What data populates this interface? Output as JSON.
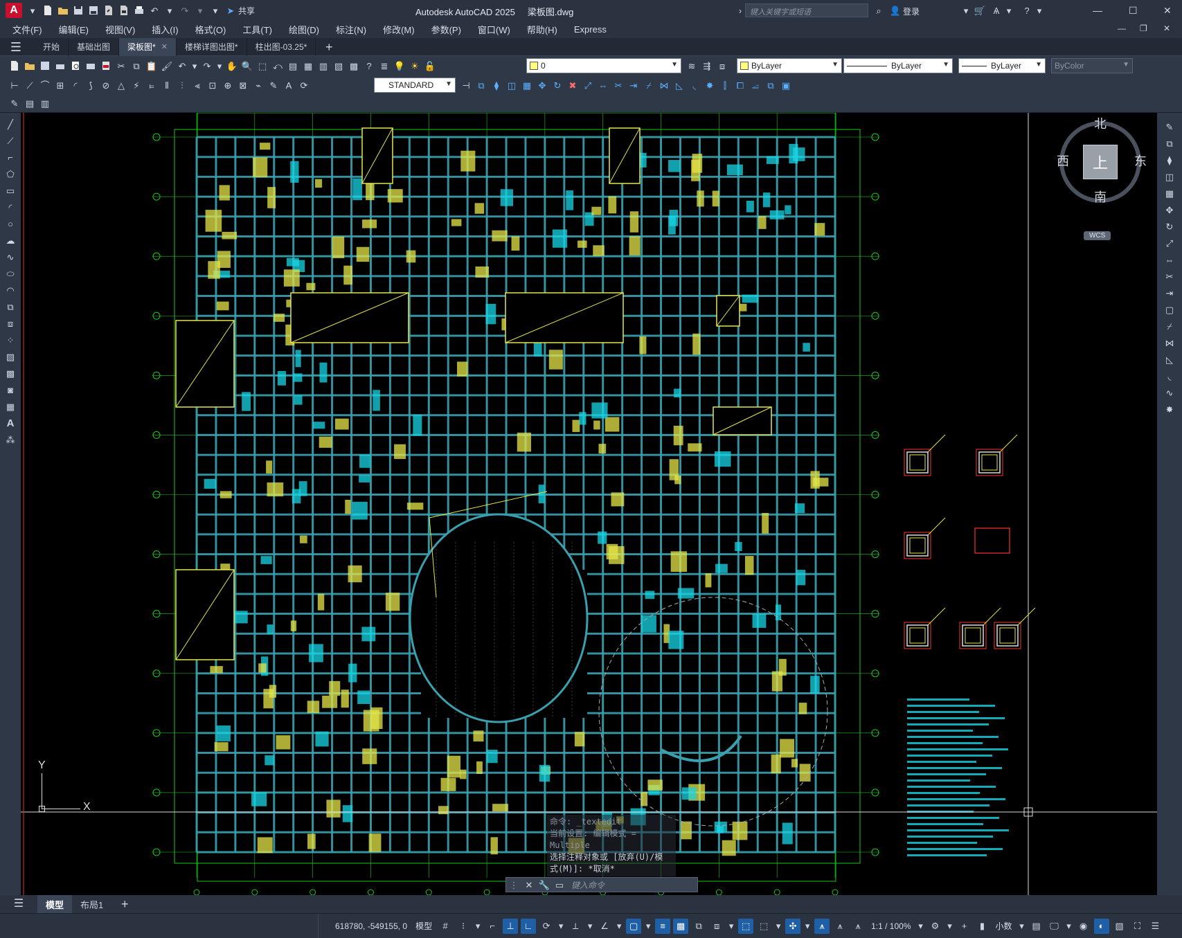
{
  "app": {
    "title": "Autodesk AutoCAD 2025",
    "filename": "梁板图.dwg",
    "search_placeholder": "键入关键字或短语",
    "login_label": "登录",
    "share_label": "共享"
  },
  "menu": {
    "items": [
      "文件(F)",
      "编辑(E)",
      "视图(V)",
      "插入(I)",
      "格式(O)",
      "工具(T)",
      "绘图(D)",
      "标注(N)",
      "修改(M)",
      "参数(P)",
      "窗口(W)",
      "帮助(H)",
      "Express"
    ]
  },
  "tabs": {
    "items": [
      {
        "label": "开始",
        "active": false
      },
      {
        "label": "基础出图",
        "active": false
      },
      {
        "label": "梁板图*",
        "active": true
      },
      {
        "label": "楼梯详图出图*",
        "active": false
      },
      {
        "label": "柱出图-03.25*",
        "active": false
      }
    ]
  },
  "props": {
    "layer_value": "0",
    "color_value": "ByLayer",
    "linetype_value": "ByLayer",
    "lineweight_value": "ByLayer",
    "plotstyle_value": "ByColor",
    "textstyle_value": "STANDARD"
  },
  "viewcube": {
    "north": "北",
    "south": "南",
    "east": "东",
    "west": "西",
    "top": "上",
    "wcs": "WCS"
  },
  "ucs": {
    "x": "X",
    "y": "Y"
  },
  "command": {
    "history": [
      "命令:  _textedit",
      "当前设置: 编辑模式 =",
      "Multiple",
      "选择注释对象或 [放弃(U)/模",
      "式(M)]: *取消*"
    ],
    "placeholder": "键入命令"
  },
  "layout_tabs": {
    "items": [
      {
        "label": "模型",
        "active": true
      },
      {
        "label": "布局1",
        "active": false
      }
    ]
  },
  "status": {
    "coordinates": "618780, -549155, 0",
    "space_label": "模型",
    "scale_label": "1:1 / 100%",
    "units_label": "小数"
  },
  "colors": {
    "beam": "#3aa0b0",
    "grid_green": "#19c819",
    "text_yellow": "#e6e64a",
    "note_cyan": "#18d6e6",
    "accent": "#1f5fa5"
  }
}
